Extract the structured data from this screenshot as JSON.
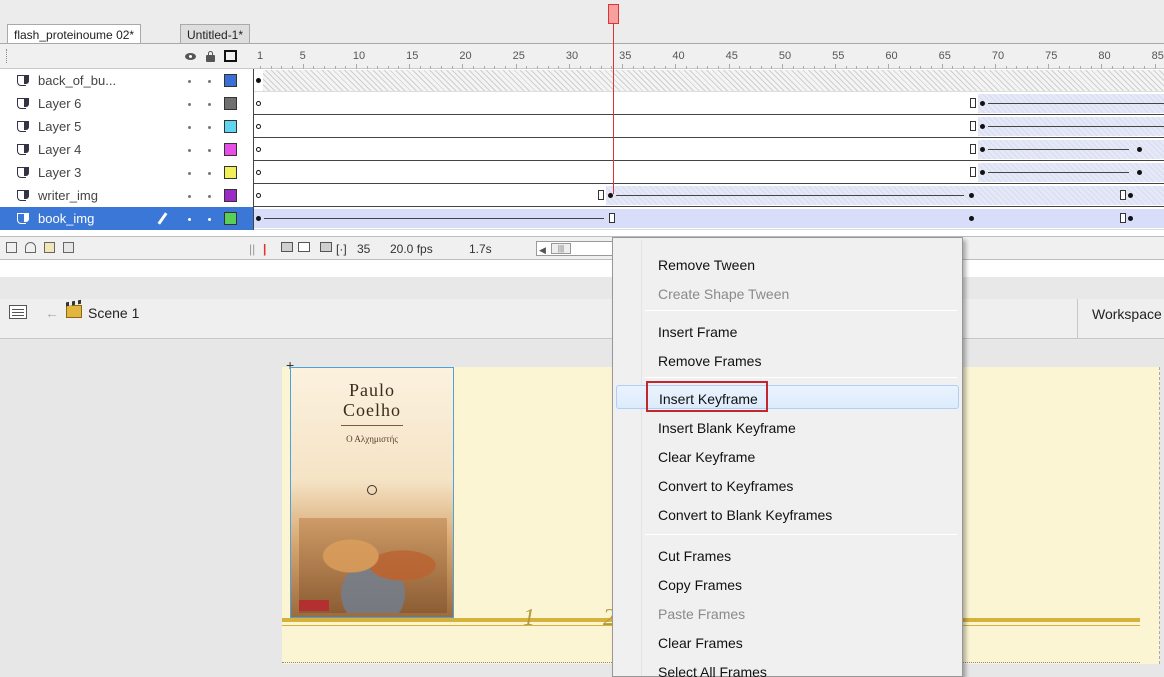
{
  "doc_tabs": [
    "flash_proteinoume 02*",
    "Untitled-1*"
  ],
  "ruler_numbers": [
    "1",
    "5",
    "10",
    "15",
    "20",
    "25",
    "30",
    "35",
    "40",
    "45",
    "50",
    "55",
    "60",
    "65",
    "70",
    "75",
    "80",
    "85"
  ],
  "layers": [
    {
      "name": "back_of_bu...",
      "color": "#3b6fd6"
    },
    {
      "name": "Layer 6",
      "color": "#707070"
    },
    {
      "name": "Layer 5",
      "color": "#5fd5f0"
    },
    {
      "name": "Layer 4",
      "color": "#e64fe6"
    },
    {
      "name": "Layer 3",
      "color": "#f2f05a"
    },
    {
      "name": "writer_img",
      "color": "#9a2bc6"
    },
    {
      "name": "book_img",
      "color": "#58d058"
    }
  ],
  "status": {
    "current_frame": "35",
    "fps": "20.0 fps",
    "time": "1.7s"
  },
  "edit_bar": {
    "scene": "Scene 1",
    "workspace": "Workspace"
  },
  "book": {
    "author_line1": "Paulo",
    "author_line2": "Coelho",
    "title": "Ο Αλχημιστής"
  },
  "stage_numbers": [
    "1",
    "2"
  ],
  "context_menu": {
    "items": [
      {
        "label": "Remove Tween",
        "disabled": false
      },
      {
        "label": "Create Shape Tween",
        "disabled": true
      },
      {
        "label": "Insert Frame",
        "disabled": false
      },
      {
        "label": "Remove Frames",
        "disabled": false
      },
      {
        "label": "Insert Keyframe",
        "disabled": false,
        "highlighted": true
      },
      {
        "label": "Insert Blank Keyframe",
        "disabled": false
      },
      {
        "label": "Clear Keyframe",
        "disabled": false
      },
      {
        "label": "Convert to Keyframes",
        "disabled": false
      },
      {
        "label": "Convert to Blank Keyframes",
        "disabled": false
      },
      {
        "label": "Cut Frames",
        "disabled": false
      },
      {
        "label": "Copy Frames",
        "disabled": false
      },
      {
        "label": "Paste Frames",
        "disabled": true
      },
      {
        "label": "Clear Frames",
        "disabled": false
      },
      {
        "label": "Select All Frames",
        "disabled": false
      }
    ]
  },
  "colors": {
    "accent_red": "#c2272d",
    "selected_layer": "#3b77d6",
    "stage": "#fbf5d4"
  }
}
